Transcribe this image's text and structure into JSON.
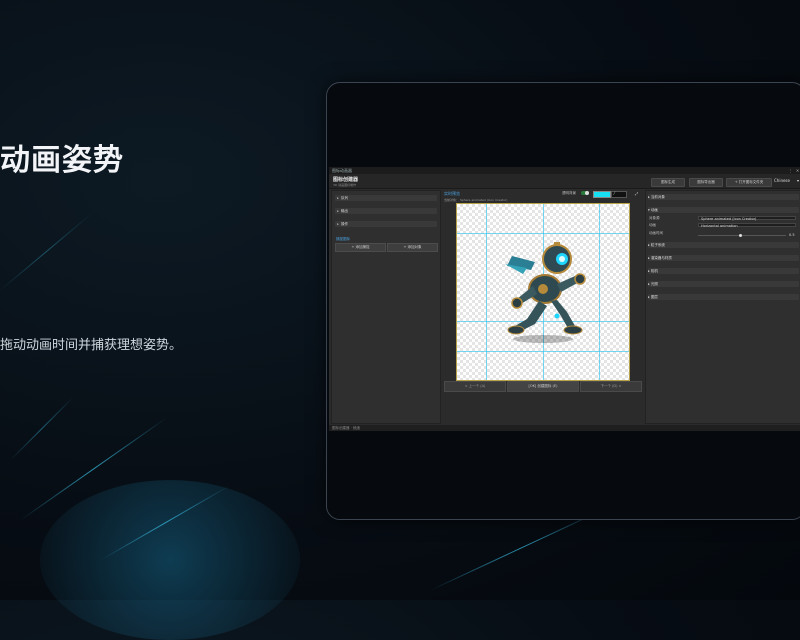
{
  "slide": {
    "title": "动画姿势",
    "description": "拖动动画时间并捕获理想姿势。"
  },
  "app": {
    "window_title": "图标动画器",
    "header": {
      "name": "图标创建器",
      "subtitle": "3D 动画图标制作",
      "buttons": [
        "图标生成",
        "图标导出器",
        "+ 打开图标文件夹"
      ],
      "language": "Chinese"
    },
    "left_panel": {
      "sections": [
        "队列",
        "输出",
        "操作"
      ],
      "capture_label": "捕捉图标",
      "buttons": [
        "+ 添加捕捉",
        "+ 添加对象"
      ]
    },
    "preview": {
      "title": "实时预览",
      "subtitle": "当前对象：  Sphere animated (Icon Creator)",
      "toggle_label": "透明背景",
      "bg_color": "#17e0f2",
      "nav": [
        "< 上一个 (A)",
        "[OK] 创建图标 (E)",
        "下一个 (D) >"
      ]
    },
    "right_panel": {
      "sections_top": [
        "当前对象"
      ],
      "animation": {
        "header": "动画",
        "rows": [
          {
            "label": "对象源",
            "value": "Sphere animated (Icon Creator)"
          },
          {
            "label": "动画",
            "value": "Horizontal animation"
          },
          {
            "label": "动画时间",
            "value": "0.5"
          }
        ]
      },
      "sections_bottom": [
        "粒子系统",
        "渲染器与材质",
        "相机",
        "光照",
        "图层"
      ]
    },
    "status": "图标创建器 · 就绪"
  }
}
